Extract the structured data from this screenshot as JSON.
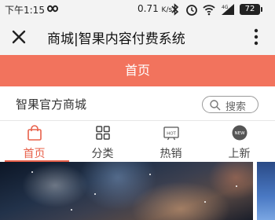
{
  "status_bar": {
    "time": "下午1:15",
    "speed": "0.71",
    "speed_unit": "K/s",
    "battery": "72"
  },
  "app_header": {
    "title": "商城|智果内容付费系统"
  },
  "page_title": "首页",
  "store": {
    "name": "智果官方商城",
    "search_label": "搜索"
  },
  "tabs": [
    {
      "label": "首页",
      "icon": "bag-icon",
      "active": true
    },
    {
      "label": "分类",
      "icon": "category-icon",
      "active": false
    },
    {
      "label": "热销",
      "icon": "hot-icon",
      "active": false
    },
    {
      "label": "上新",
      "icon": "new-icon",
      "active": false
    }
  ],
  "colors": {
    "accent": "#f2735d",
    "active_tab": "#e8604a",
    "header_bg": "#f3f3f3"
  }
}
